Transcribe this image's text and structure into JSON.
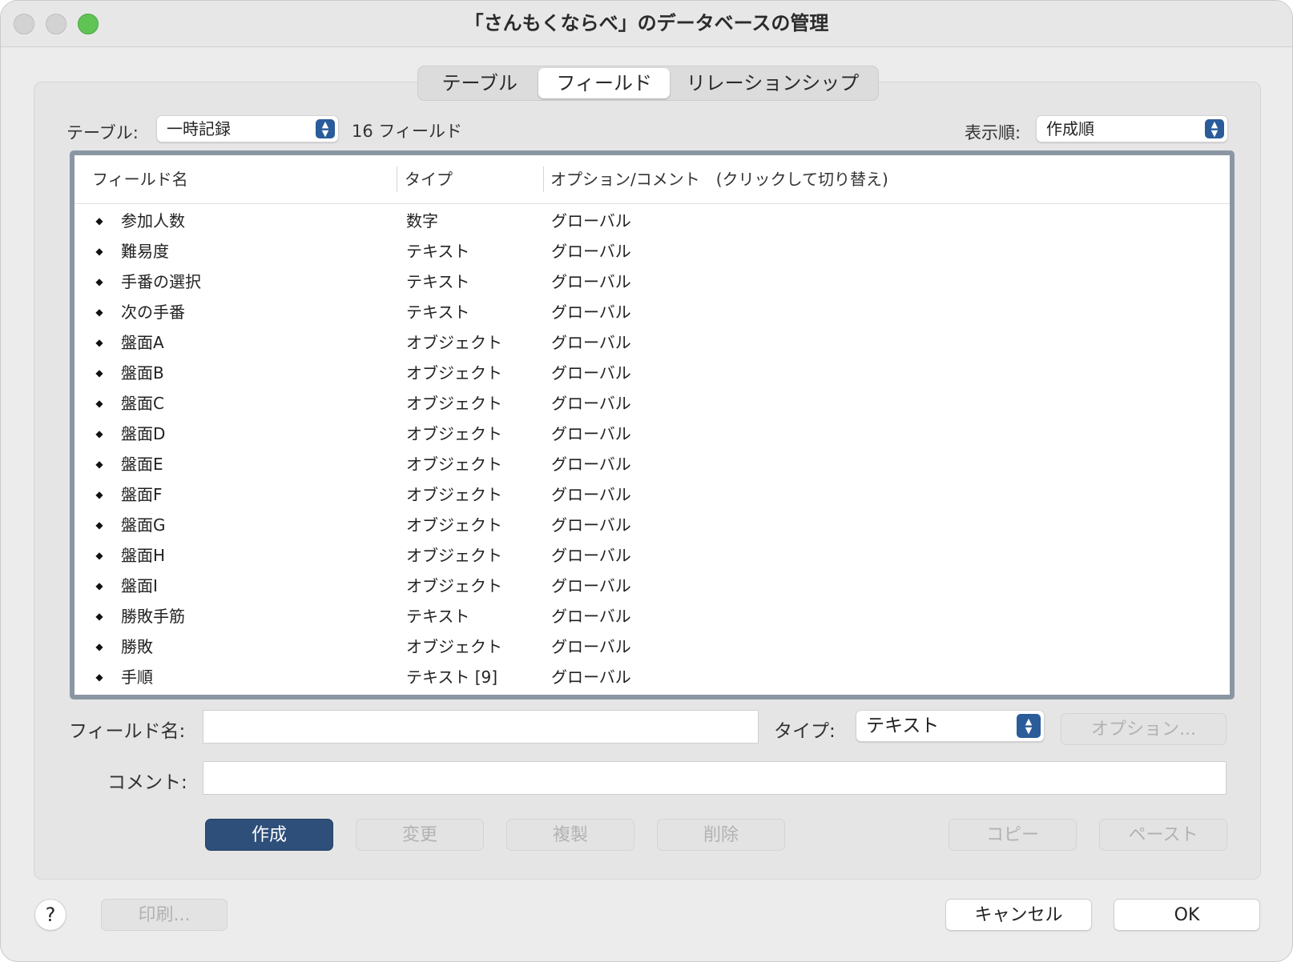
{
  "window": {
    "title": "「さんもくならべ」のデータベースの管理"
  },
  "tabs": [
    {
      "label": "テーブル"
    },
    {
      "label": "フィールド"
    },
    {
      "label": "リレーションシップ"
    }
  ],
  "toolbar": {
    "table_label": "テーブル:",
    "table_value": "一時記録",
    "field_count": "16 フィールド",
    "sort_label": "表示順:",
    "sort_value": "作成順"
  },
  "list": {
    "headers": [
      "フィールド名",
      "タイプ",
      "オプション/コメント　(クリックして切り替え)"
    ],
    "rows": [
      {
        "name": "参加人数",
        "type": "数字",
        "option": "グローバル"
      },
      {
        "name": "難易度",
        "type": "テキスト",
        "option": "グローバル"
      },
      {
        "name": "手番の選択",
        "type": "テキスト",
        "option": "グローバル"
      },
      {
        "name": "次の手番",
        "type": "テキスト",
        "option": "グローバル"
      },
      {
        "name": "盤面A",
        "type": "オブジェクト",
        "option": "グローバル"
      },
      {
        "name": "盤面B",
        "type": "オブジェクト",
        "option": "グローバル"
      },
      {
        "name": "盤面C",
        "type": "オブジェクト",
        "option": "グローバル"
      },
      {
        "name": "盤面D",
        "type": "オブジェクト",
        "option": "グローバル"
      },
      {
        "name": "盤面E",
        "type": "オブジェクト",
        "option": "グローバル"
      },
      {
        "name": "盤面F",
        "type": "オブジェクト",
        "option": "グローバル"
      },
      {
        "name": "盤面G",
        "type": "オブジェクト",
        "option": "グローバル"
      },
      {
        "name": "盤面H",
        "type": "オブジェクト",
        "option": "グローバル"
      },
      {
        "name": "盤面I",
        "type": "オブジェクト",
        "option": "グローバル"
      },
      {
        "name": "勝敗手筋",
        "type": "テキスト",
        "option": "グローバル"
      },
      {
        "name": "勝敗",
        "type": "オブジェクト",
        "option": "グローバル"
      },
      {
        "name": "手順",
        "type": "テキスト [9]",
        "option": "グローバル"
      }
    ]
  },
  "editor": {
    "field_name_label": "フィールド名:",
    "field_name_value": "",
    "type_label": "タイプ:",
    "type_value": "テキスト",
    "options_button": "オプション...",
    "comment_label": "コメント:",
    "comment_value": ""
  },
  "actions": {
    "create": "作成",
    "change": "変更",
    "duplicate": "複製",
    "delete": "削除",
    "copy": "コピー",
    "paste": "ペースト"
  },
  "footer": {
    "help": "?",
    "print": "印刷...",
    "cancel": "キャンセル",
    "ok": "OK"
  },
  "icons": {
    "row_handle": "updown-arrow-icon",
    "popup_stepper": "chevron-updown-icon"
  },
  "colors": {
    "primary_button": "#2e4f7a",
    "stepper": "#2a5c9a",
    "list_frame": "#8b96a3",
    "zoom_button": "#5fc454"
  }
}
